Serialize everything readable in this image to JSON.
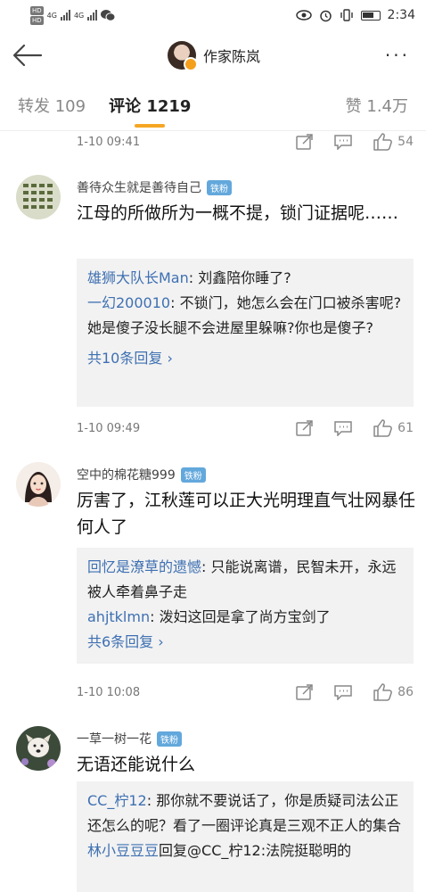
{
  "status": {
    "net_1": "4G",
    "net_2": "4G",
    "hd_1": "HD",
    "hd_2": "HD",
    "time": "2:34"
  },
  "nav": {
    "title": "作家陈岚",
    "more": "···"
  },
  "tabs": {
    "forward": "转发 109",
    "comments": "评论 1219",
    "likes": "赞 1.4万"
  },
  "top_row": {
    "time": "1-10 09:41",
    "likes": "54"
  },
  "comments": [
    {
      "user": "善待众生就是善待自己",
      "badge": "铁粉",
      "text": "江母的所做所为一概不提，锁门证据呢……",
      "replies": [
        {
          "who": "雄狮大队长Man",
          "text": ": 刘鑫陪你睡了?"
        },
        {
          "who": "一幻200010",
          "text": ": 不锁门，她怎么会在门口被杀害呢?她是傻子没长腿不会进屋里躲嘛?你也是傻子?"
        }
      ],
      "more": "共10条回复 ›",
      "time": "1-10 09:49",
      "likes": "61"
    },
    {
      "user": "空中的棉花糖999",
      "badge": "铁粉",
      "text": "厉害了，江秋莲可以正大光明理直气壮网暴任何人了",
      "replies": [
        {
          "who": "回忆是潦草的遗憾",
          "text": ": 只能说离谱，民智未开，永远被人牵着鼻子走"
        },
        {
          "who": "ahjtklmn",
          "text": ": 泼妇这回是拿了尚方宝剑了"
        }
      ],
      "more": "共6条回复 ›",
      "time": "1-10 10:08",
      "likes": "86"
    },
    {
      "user": "一草一树一花",
      "badge": "铁粉",
      "text": "无语还能说什么",
      "replies": [
        {
          "who": "CC_柠12",
          "text": ": 那你就不要说话了，你是质疑司法公正还怎么的呢？看了一圈评论真是三观不正人的集合"
        },
        {
          "who": "林小豆豆豆",
          "text": "回复@CC_柠12:法院挺聪明的"
        }
      ]
    }
  ],
  "colors": {
    "accent": "#f5a623",
    "link": "#3e70b2",
    "badge": "#63a8dc"
  }
}
